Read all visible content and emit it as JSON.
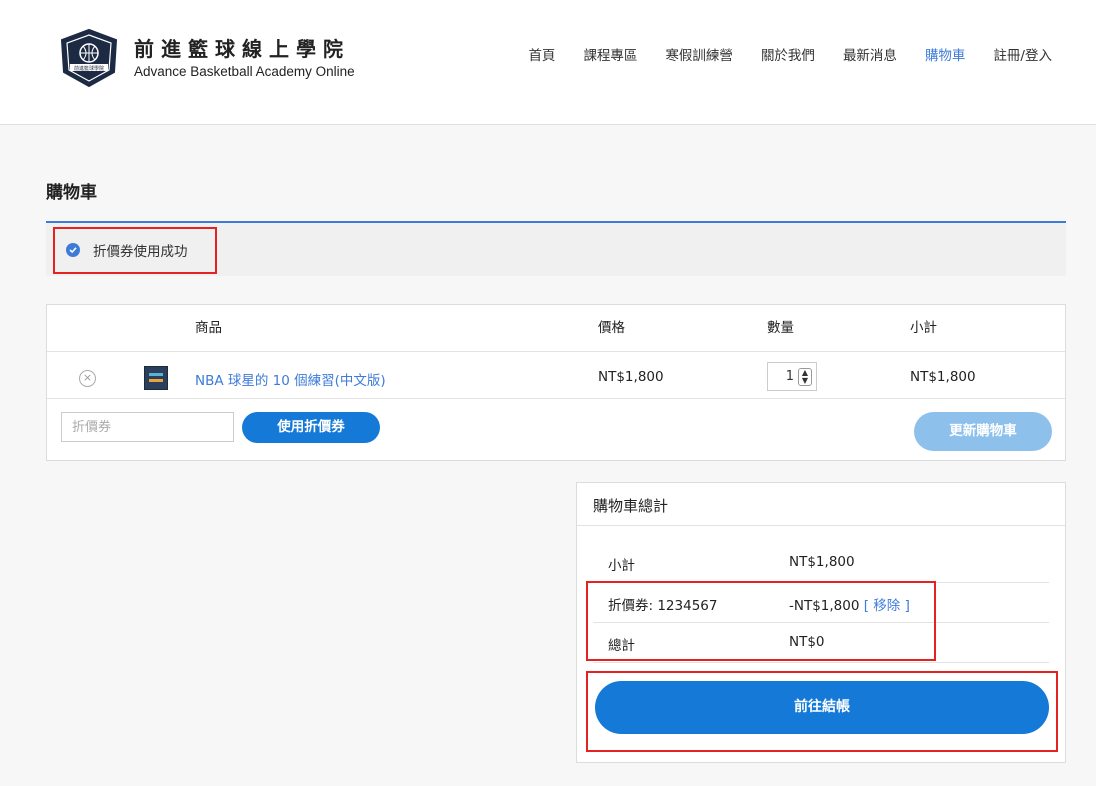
{
  "brand": {
    "name_zh": "前進籃球線上學院",
    "name_en": "Advance Basketball Academy Online",
    "logo_text": "前進籃球學院"
  },
  "nav": {
    "items": [
      {
        "label": "首頁",
        "active": false
      },
      {
        "label": "課程專區",
        "active": false
      },
      {
        "label": "寒假訓練營",
        "active": false
      },
      {
        "label": "關於我們",
        "active": false
      },
      {
        "label": "最新消息",
        "active": false
      },
      {
        "label": "購物車",
        "active": true
      },
      {
        "label": "註冊/登入",
        "active": false
      }
    ]
  },
  "page": {
    "title": "購物車"
  },
  "notice": {
    "message": "折價券使用成功"
  },
  "cart": {
    "headers": {
      "product": "商品",
      "price": "價格",
      "quantity": "數量",
      "subtotal": "小計"
    },
    "items": [
      {
        "name": "NBA 球星的 10 個練習(中文版)",
        "price": "NT$1,800",
        "quantity": "1",
        "subtotal": "NT$1,800"
      }
    ],
    "coupon_placeholder": "折價券",
    "apply_label": "使用折價券",
    "update_label": "更新購物車"
  },
  "totals": {
    "title": "購物車總計",
    "subtotal_label": "小計",
    "subtotal_value": "NT$1,800",
    "coupon_label": "折價券: 1234567",
    "coupon_value": "-NT$1,800",
    "remove_label": "[ 移除 ]",
    "total_label": "總計",
    "total_value": "NT$0",
    "checkout_label": "前往結帳"
  },
  "colors": {
    "accent": "#1479d7",
    "link": "#3d7bd9",
    "highlight": "#e52222"
  }
}
